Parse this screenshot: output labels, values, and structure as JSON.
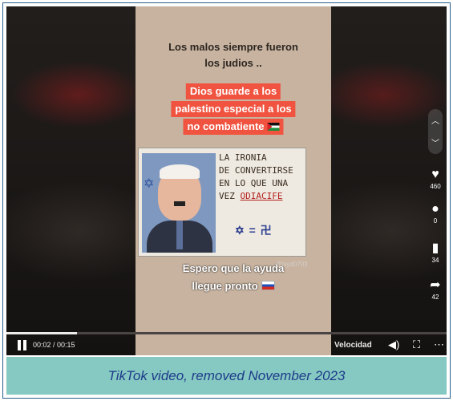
{
  "video": {
    "overlay_text": {
      "line1": "Los malos siempre fueron",
      "line2": "los judios ..",
      "red_line1": "Dios guarde a los",
      "red_line2": "palestino especial a los",
      "red_line3": "no combatiente",
      "bottom_line1": "Espero que la ayuda",
      "bottom_line2": "llegue pronto"
    },
    "poster": {
      "line1": "LA IRONIA",
      "line2": "DE CONVERTIRSE",
      "line3": "EN LO QUE UNA",
      "line4_a": "VEZ",
      "line4_b": "ODIACIFE",
      "equation": "✡ = 卍"
    },
    "watermark": "@tsyd0703"
  },
  "side_actions": {
    "nav_up_icon": "chevron-up-icon",
    "nav_down_icon": "chevron-down-icon",
    "likes": "460",
    "comments": "0",
    "saves": "34",
    "shares": "42"
  },
  "player": {
    "progress": 0.16,
    "time": "00:02 / 00:15",
    "speed_label": "Velocidad"
  },
  "caption": "TikTok video, removed November 2023",
  "colors": {
    "red_highlight": "#f0533f",
    "caption_bar": "#85c9c2",
    "caption_text": "#1e3a8a"
  }
}
